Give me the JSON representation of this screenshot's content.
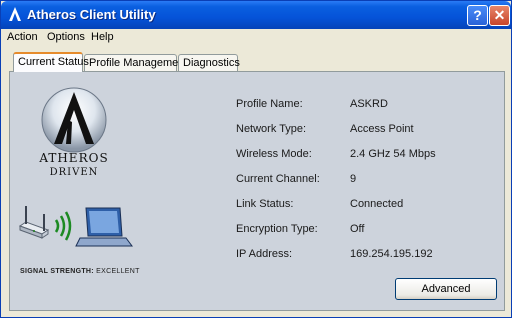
{
  "window": {
    "title": "Atheros Client Utility"
  },
  "titlebar": {
    "help_label": "?",
    "close_label": "✕"
  },
  "menu": [
    "Action",
    "Options",
    "Help"
  ],
  "tabs": [
    "Current Status",
    "Profile Management",
    "Diagnostics"
  ],
  "logo": {
    "line1": "ATHEROS",
    "line2": "DRIVEN"
  },
  "status": [
    {
      "label": "Profile Name:",
      "value": "ASKRD"
    },
    {
      "label": "Network Type:",
      "value": "Access Point"
    },
    {
      "label": "Wireless Mode:",
      "value": "2.4 GHz 54 Mbps"
    },
    {
      "label": "Current Channel:",
      "value": "9"
    },
    {
      "label": "Link Status:",
      "value": "Connected"
    },
    {
      "label": "Encryption Type:",
      "value": "Off"
    },
    {
      "label": "IP Address:",
      "value": "169.254.195.192"
    }
  ],
  "signal": {
    "label": "SIGNAL STRENGTH:",
    "value": "EXCELLENT"
  },
  "buttons": {
    "advanced": "Advanced"
  },
  "colors": {
    "titlebar": "#0553d8",
    "panel": "#cdd3dc",
    "active_tab_accent": "#e68b2c"
  }
}
